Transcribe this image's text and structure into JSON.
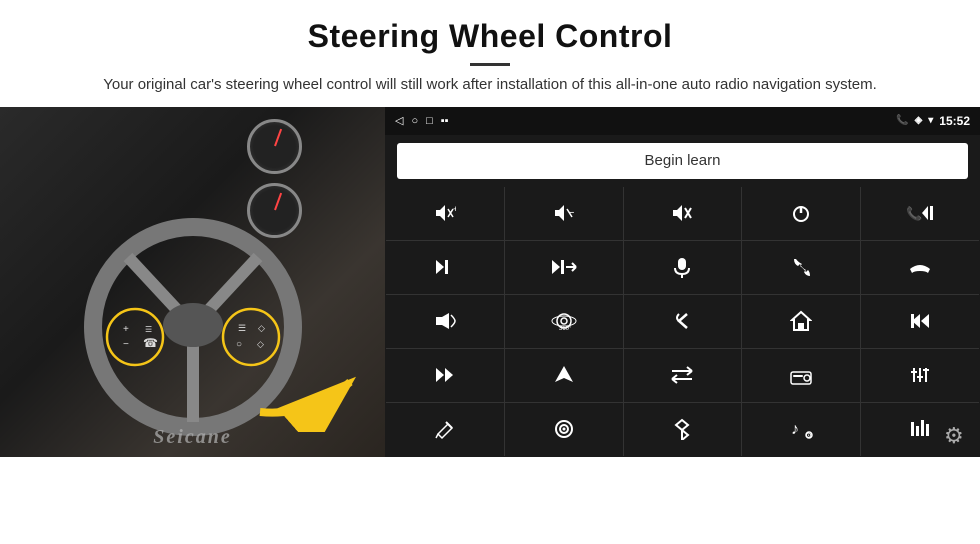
{
  "header": {
    "title": "Steering Wheel Control",
    "description": "Your original car's steering wheel control will still work after installation of this all-in-one auto radio navigation system."
  },
  "status_bar": {
    "back_icon": "◁",
    "circle_icon": "○",
    "square_icon": "□",
    "signal_icon": "▪▪",
    "phone_icon": "📞",
    "location_icon": "◈",
    "wifi_icon": "▾",
    "time": "15:52"
  },
  "begin_learn_button": "Begin learn",
  "controls": [
    {
      "icon": "🔊+",
      "label": "vol-up"
    },
    {
      "icon": "🔊−",
      "label": "vol-down"
    },
    {
      "icon": "🔇",
      "label": "mute"
    },
    {
      "icon": "⏻",
      "label": "power"
    },
    {
      "icon": "⏮",
      "label": "prev-track-phone"
    },
    {
      "icon": "⏭",
      "label": "next"
    },
    {
      "icon": "⏩",
      "label": "fast-forward"
    },
    {
      "icon": "🎤",
      "label": "mic"
    },
    {
      "icon": "📞",
      "label": "answer"
    },
    {
      "icon": "📵",
      "label": "hang-up"
    },
    {
      "icon": "📢",
      "label": "horn"
    },
    {
      "icon": "⚙",
      "label": "360"
    },
    {
      "icon": "↩",
      "label": "back"
    },
    {
      "icon": "🏠",
      "label": "home"
    },
    {
      "icon": "⏮⏮",
      "label": "prev"
    },
    {
      "icon": "⏭",
      "label": "skip"
    },
    {
      "icon": "➤",
      "label": "nav"
    },
    {
      "icon": "⇌",
      "label": "swap"
    },
    {
      "icon": "📻",
      "label": "radio"
    },
    {
      "icon": "⚙⚙",
      "label": "eq"
    },
    {
      "icon": "✏",
      "label": "edit"
    },
    {
      "icon": "⏺",
      "label": "record"
    },
    {
      "icon": "✱",
      "label": "bluetooth"
    },
    {
      "icon": "🎵",
      "label": "music"
    },
    {
      "icon": "▐▌",
      "label": "bars"
    }
  ],
  "watermark": "Seicane",
  "gear_icon": "⚙"
}
